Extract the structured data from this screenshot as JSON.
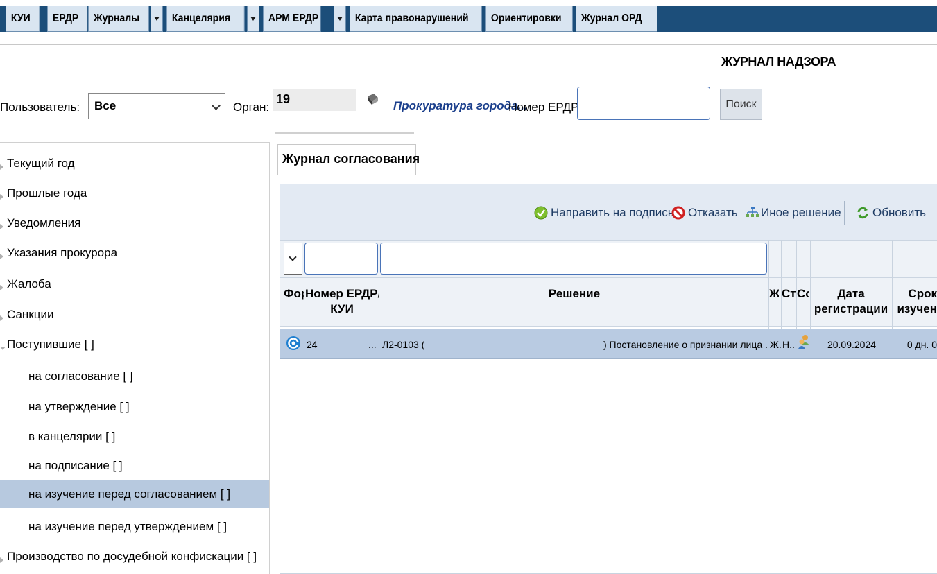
{
  "nav": {
    "items": [
      {
        "label": "КУИ"
      },
      {
        "label": "ЕРДР"
      },
      {
        "label": "Журналы"
      },
      {
        "label": "Канцелярия"
      },
      {
        "label": "АРМ ЕРДР"
      },
      {
        "label": "Карта правонарушений"
      },
      {
        "label": "Ориентировки"
      },
      {
        "label": "Журнал ОРД"
      }
    ]
  },
  "page_title": "ЖУРНАЛ НАДЗОРА",
  "filters": {
    "user_label": "Пользователь:",
    "user_value": "Все",
    "organ_label": "Орган:",
    "organ_value": "19",
    "organ_link": "Прокуратура города...",
    "erdr_label": "Номер ЕРДР",
    "erdr_value": "",
    "search_button": "Поиск"
  },
  "tree": {
    "items": [
      {
        "label": "Текущий год"
      },
      {
        "label": "Прошлые года"
      },
      {
        "label": "Уведомления"
      },
      {
        "label": "Указания прокурора"
      },
      {
        "label": "Жалоба"
      },
      {
        "label": "Санкции"
      },
      {
        "label": "Поступившие [    ]"
      },
      {
        "label": "на согласование [ ]"
      },
      {
        "label": "на утверждение [ ]"
      },
      {
        "label": "в канцелярии [ ]"
      },
      {
        "label": "на подписание [ ]"
      },
      {
        "label": "на изучение перед согласованием [    ]"
      },
      {
        "label": "на изучение перед утверждением [    ]"
      },
      {
        "label": "Производство по досудебной конфискации [ ]"
      }
    ]
  },
  "tab": {
    "label": "Журнал согласования"
  },
  "toolbar": {
    "send_to_sign": "Направить на подпись",
    "refuse": "Отказать",
    "other_decision": "Иное решение",
    "refresh": "Обновить"
  },
  "grid": {
    "columns": {
      "form": "Фор",
      "number_line1": "Номер ЕРДР/",
      "number_line2": "КУИ",
      "decision": "Решение",
      "zh": "Ж",
      "st": "Ст",
      "so": "Со",
      "reg_date_line1": "Дата",
      "reg_date_line2": "регистрации",
      "term_line1": "Срок",
      "term_line2": "изучен"
    },
    "rows": [
      {
        "number": "24",
        "number_ellipsis": "...",
        "decision_left": "Л2-0103 (",
        "decision_right": ") Постановление о признании лица ...",
        "zh": "Ж.",
        "st": "Н...",
        "reg_date": "20.09.2024",
        "term": "0 дн. 0"
      }
    ]
  },
  "colors": {
    "nav_bar": "#1c4e7a",
    "nav_item": "#d9e5f1",
    "selected_row": "#b9cbe2",
    "link": "#1b3f8c",
    "toolbar_bg": "#e3eaf3"
  }
}
